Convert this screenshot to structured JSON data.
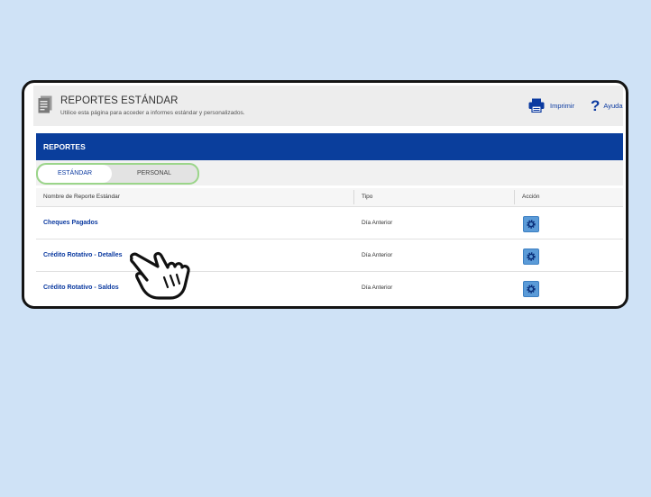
{
  "header": {
    "title": "REPORTES ESTÁNDAR",
    "subtitle": "Utilice esta página para acceder a informes estándar y personalizados.",
    "print_label": "Imprimir",
    "help_label": "Ayuda"
  },
  "banner": {
    "title": "REPORTES"
  },
  "tabs": [
    {
      "label": "ESTÁNDAR",
      "selected": true
    },
    {
      "label": "PERSONAL",
      "selected": false
    }
  ],
  "table": {
    "columns": [
      "Nombre de Reporte Estándar",
      "Tipo",
      "Acción"
    ],
    "rows": [
      {
        "name": "Cheques Pagados",
        "type": "Día Anterior",
        "action_icon": "gear-icon"
      },
      {
        "name": "Crédito Rotativo - Detalles",
        "type": "Día Anterior",
        "action_icon": "gear-icon"
      },
      {
        "name": "Crédito Rotativo - Saldos",
        "type": "Día Anterior",
        "action_icon": "gear-icon"
      }
    ]
  },
  "colors": {
    "page_background": "#cfe2f6",
    "banner_blue": "#0a3e9c",
    "link_blue": "#0b3aa0",
    "tab_highlight": "#9bd58a",
    "gear_button": "#5b9bd8"
  },
  "icons": {
    "header": "report-document-icon",
    "print": "printer-icon",
    "help": "help-question-icon",
    "pointer": "pointing-hand-icon"
  }
}
